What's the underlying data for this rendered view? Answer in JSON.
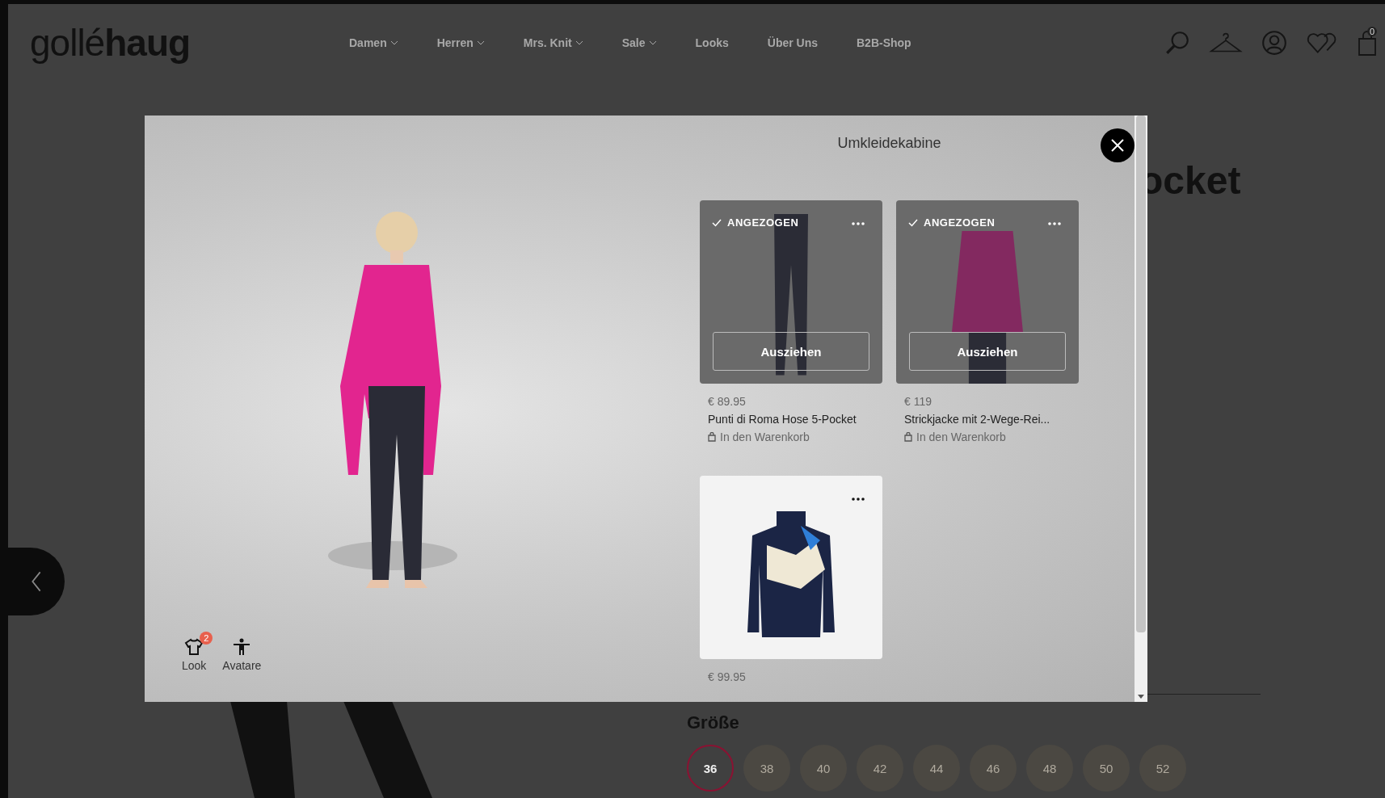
{
  "header": {
    "logo": "gollé**haug**",
    "nav": [
      {
        "label": "Damen",
        "dropdown": true
      },
      {
        "label": "Herren",
        "dropdown": true
      },
      {
        "label": "Mrs. Knit",
        "dropdown": true
      },
      {
        "label": "Sale",
        "dropdown": true
      },
      {
        "label": "Looks",
        "dropdown": false
      },
      {
        "label": "Über Uns",
        "dropdown": false
      },
      {
        "label": "B2B-Shop",
        "dropdown": false
      }
    ],
    "cart_count": "0"
  },
  "page": {
    "heading": "ocket",
    "size_label": "Größe",
    "sizes": [
      {
        "label": "36",
        "selected": true
      },
      {
        "label": "38",
        "selected": false
      },
      {
        "label": "40",
        "selected": false
      },
      {
        "label": "42",
        "selected": false
      },
      {
        "label": "44",
        "selected": false
      },
      {
        "label": "46",
        "selected": false
      },
      {
        "label": "48",
        "selected": false
      },
      {
        "label": "50",
        "selected": false
      },
      {
        "label": "52",
        "selected": false
      }
    ]
  },
  "modal": {
    "title": "Umkleidekabine",
    "items": [
      {
        "kind": "trousers",
        "worn": true,
        "worn_label": "ANGEZOGEN",
        "action": "Ausziehen",
        "price": "€ 89.95",
        "name": "Punti di Roma Hose 5-Pocket",
        "cart_label": "In den Warenkorb"
      },
      {
        "kind": "jacket",
        "worn": true,
        "worn_label": "ANGEZOGEN",
        "action": "Ausziehen",
        "price": "€ 119",
        "name": "Strickjacke mit 2-Wege-Rei...",
        "cart_label": "In den Warenkorb"
      },
      {
        "kind": "sweater",
        "worn": false,
        "price": "€ 99.95"
      }
    ],
    "toolbar": [
      {
        "kind": "shirt",
        "label": "Look",
        "badge": "2"
      },
      {
        "kind": "person",
        "label": "Avatare"
      }
    ]
  }
}
